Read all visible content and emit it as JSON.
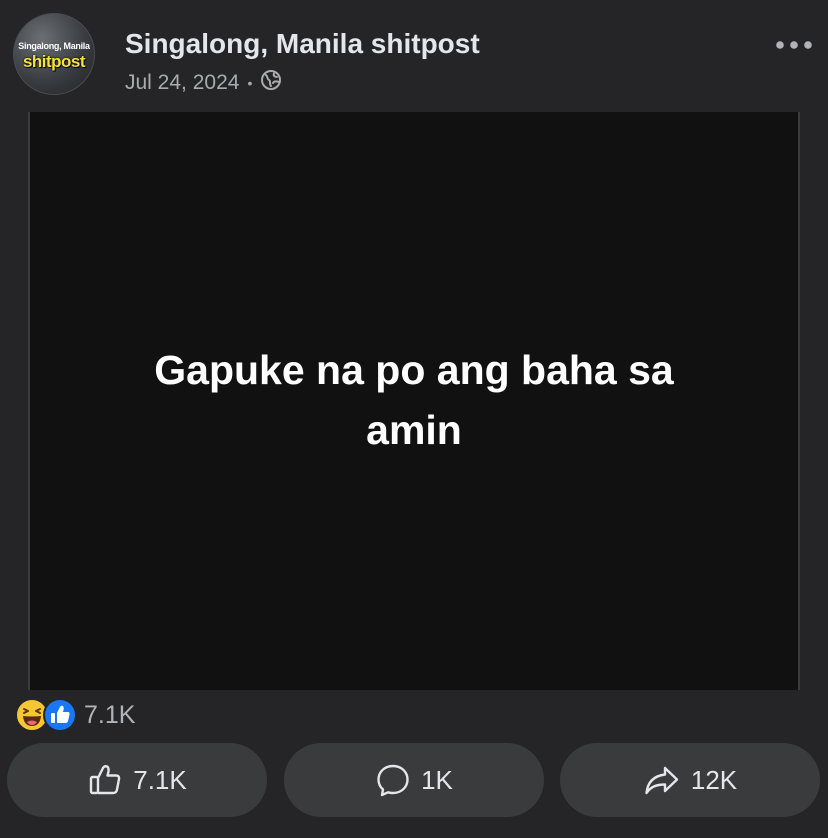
{
  "post": {
    "avatar": {
      "line1": "Singalong, Manila",
      "line2": "shitpost"
    },
    "page_name": "Singalong, Manila shitpost",
    "date": "Jul 24, 2024",
    "separator": "•",
    "privacy_icon": "globe-icon",
    "more_icon": "more-options-icon",
    "media_text": "Gapuke na po ang baha sa amin"
  },
  "reactions": {
    "icons": [
      "haha-reaction-icon",
      "like-reaction-icon"
    ],
    "count": "7.1K"
  },
  "actions": {
    "like": {
      "icon": "thumbs-up-icon",
      "label": "7.1K"
    },
    "comment": {
      "icon": "comment-bubble-icon",
      "label": "1K"
    },
    "share": {
      "icon": "share-arrow-icon",
      "label": "12K"
    }
  },
  "colors": {
    "background": "#252527",
    "media_background": "#111112",
    "button_background": "#3a3b3d",
    "like_blue": "#1877f2",
    "haha_yellow": "#f7c633"
  }
}
